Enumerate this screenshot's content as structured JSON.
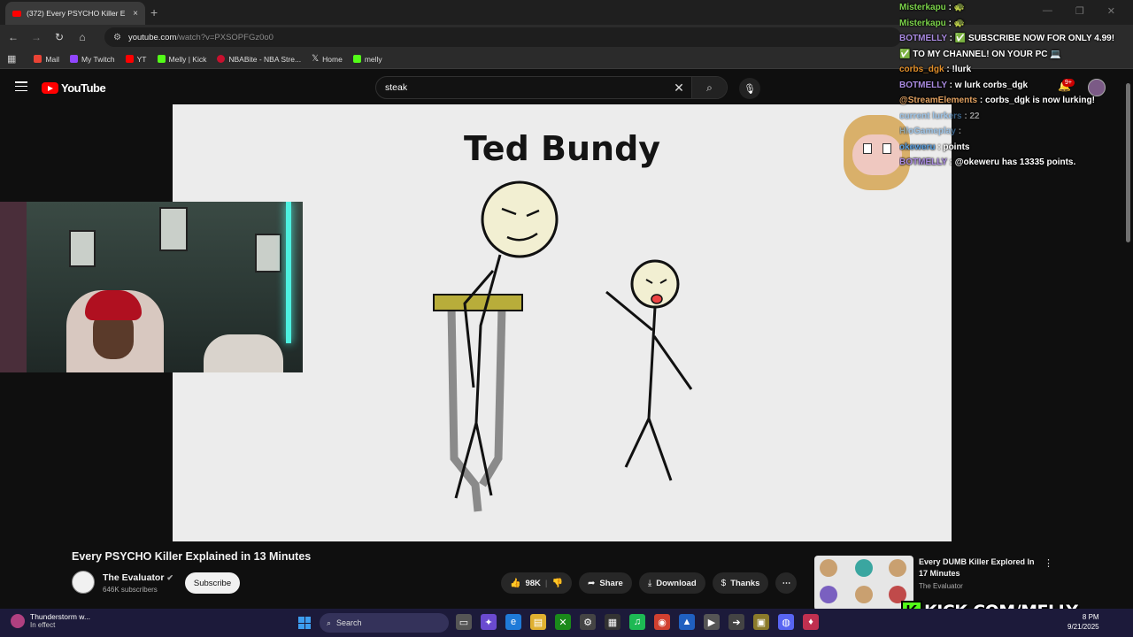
{
  "browser": {
    "tab_title": "(372) Every PSYCHO Killer E",
    "tab_close": "×",
    "new_tab": "+",
    "url_host": "youtube.com",
    "url_path": "/watch?v=PXSOPFGz0o0",
    "bookmarks": [
      "Mail",
      "My Twitch",
      "YT",
      "Melly | Kick",
      "NBABite - NBA Stre...",
      "Home",
      "melly"
    ]
  },
  "youtube": {
    "logo_text": "YouTube",
    "search_query": "steak",
    "notif_count": "9+",
    "video_title": "Every PSYCHO Killer Explained in 13 Minutes",
    "channel_name": "The Evaluator",
    "channel_subs": "646K subscribers",
    "subscribe_label": "Subscribe",
    "likes": "98K",
    "share_label": "Share",
    "download_label": "Download",
    "thanks_label": "Thanks",
    "related": {
      "title": "Every DUMB Killer Explored In 17 Minutes",
      "channel": "The Evaluator"
    }
  },
  "video_frame": {
    "heading": "Ted Bundy"
  },
  "chat": [
    {
      "user": "Misterkapu",
      "text": " : 🐢",
      "cls": "u1",
      "faded": false
    },
    {
      "user": "Misterkapu",
      "text": " : 🐢",
      "cls": "u1",
      "faded": false
    },
    {
      "user": "BOTMELLY",
      "text": " : ✅ SUBSCRIBE NOW FOR ONLY 4.99!",
      "cls": "u2",
      "faded": false
    },
    {
      "user": "",
      "text": "✅ TO MY CHANNEL! ON YOUR PC 💻",
      "cls": "u2",
      "faded": false
    },
    {
      "user": "corbs_dgk",
      "text": " : !lurk",
      "cls": "u3",
      "faded": false
    },
    {
      "user": "BOTMELLY",
      "text": " : w lurk corbs_dgk",
      "cls": "u2",
      "faded": false
    },
    {
      "user": "@StreamElements",
      "text": " : corbs_dgk is now lurking!",
      "cls": "u4",
      "faded": false
    },
    {
      "user": "current lurkers",
      "text": " : 22",
      "cls": "u5",
      "faded": true
    },
    {
      "user": "HloGameplay",
      "text": " : ",
      "cls": "u5",
      "faded": true
    },
    {
      "user": "okeweru",
      "text": " : points",
      "cls": "u5",
      "faded": false
    },
    {
      "user": "BOTMELLY",
      "text": " : @okeweru has 13335 points.",
      "cls": "u2",
      "faded": false
    }
  ],
  "overlay": {
    "kick_k": "K",
    "kick_text": "KICK.COM/MELLY"
  },
  "taskbar": {
    "weather_title": "Thunderstorm w...",
    "weather_sub": "In effect",
    "search_label": "Search",
    "time": "8 PM",
    "date": "9/21/2025"
  },
  "colors": {
    "accent_red": "#ff0000",
    "kick_green": "#53fc18",
    "chat_green": "#7bd24a",
    "chat_purple": "#a98ae0"
  }
}
